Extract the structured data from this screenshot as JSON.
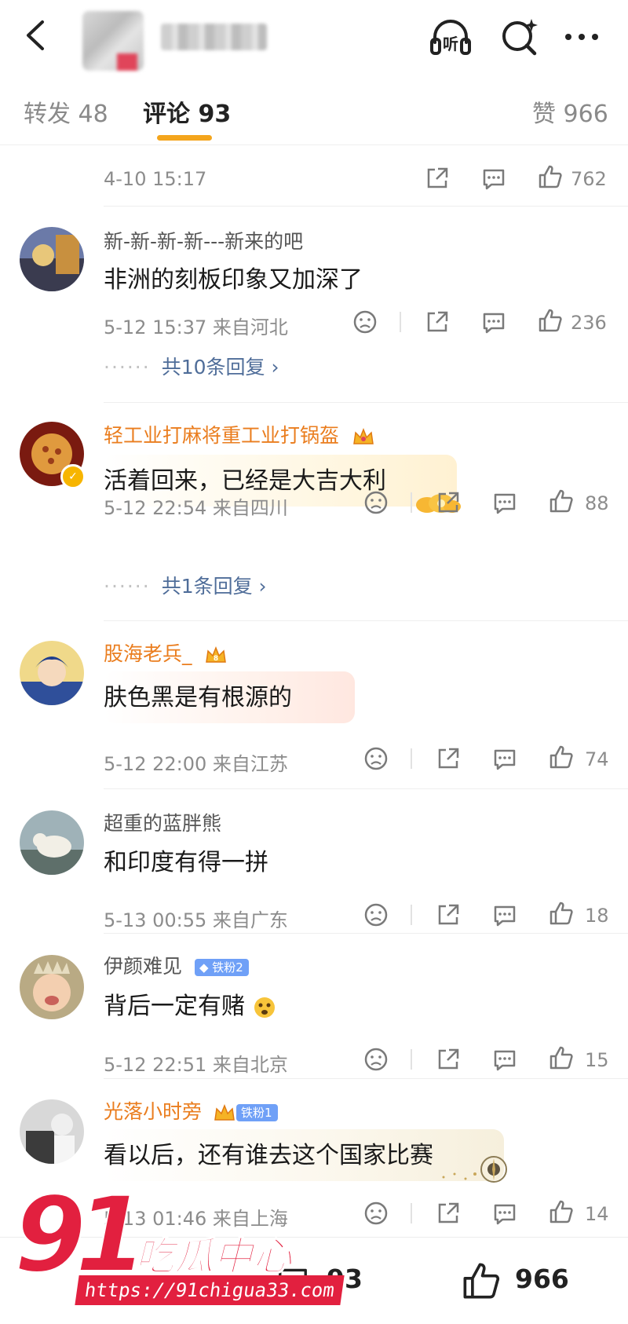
{
  "header": {
    "listen_label": "听"
  },
  "tabs": {
    "repost": "转发 48",
    "comment": "评论 93",
    "likes": "赞 966"
  },
  "comments": [
    {
      "time": "4-10 15:17",
      "likes": "762"
    },
    {
      "name": "新-新-新-新---新来的吧",
      "text": "非洲的刻板印象又加深了",
      "time": "5-12 15:37  来自河北",
      "likes": "236",
      "replies": "共10条回复 ›"
    },
    {
      "name": "轻工业打麻将重工业打锅盔",
      "text": "活着回来，已经是大吉大利",
      "time": "5-12 22:54  来自四川",
      "likes": "88",
      "replies": "共1条回复 ›"
    },
    {
      "name": "股海老兵_",
      "text": "肤色黑是有根源的",
      "time": "5-12 22:00  来自江苏",
      "likes": "74"
    },
    {
      "name": "超重的蓝胖熊",
      "text": "和印度有得一拼",
      "time": "5-13 00:55  来自广东",
      "likes": "18"
    },
    {
      "name": "伊颜难见",
      "badge": "铁粉2",
      "text": "背后一定有赌",
      "time": "5-12 22:51  来自北京",
      "likes": "15"
    },
    {
      "name": "光落小时旁",
      "badge": "铁粉1",
      "text": "看以后，还有谁去这个国家比赛",
      "time": "5-13 01:46  来自上海",
      "likes": "14"
    }
  ],
  "bottom_bar": {
    "comment_count": "93",
    "like_count": "966"
  },
  "watermark": {
    "number": "91",
    "title": "吃瓜中心",
    "url": "https://91chigua33.com"
  },
  "colors": {
    "accent": "#f4a51c",
    "vip_name": "#ea7d1e",
    "reply_link": "#4f6d99",
    "watermark": "#e2203f"
  }
}
